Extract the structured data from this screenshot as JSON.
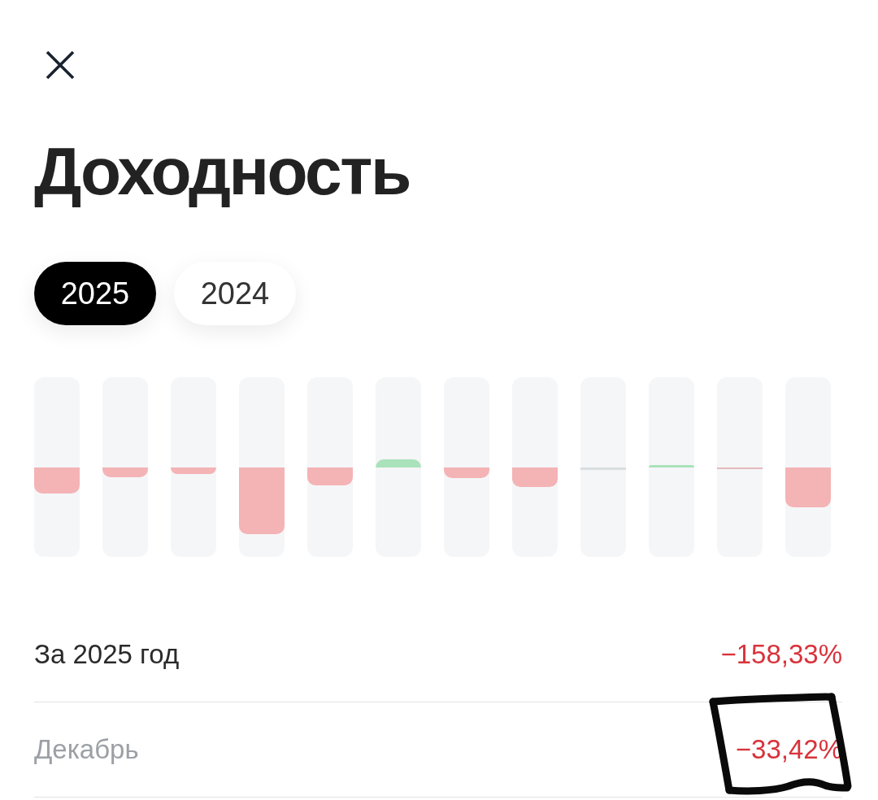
{
  "title": "Доходность",
  "year_tabs": [
    {
      "label": "2025",
      "selected": true
    },
    {
      "label": "2024",
      "selected": false
    }
  ],
  "summary": [
    {
      "kind": "total",
      "label": "За 2025 год",
      "value": "−158,33%",
      "marked": false
    },
    {
      "kind": "month",
      "label": "Декабрь",
      "value": "−33,42%",
      "marked": true
    }
  ]
}
